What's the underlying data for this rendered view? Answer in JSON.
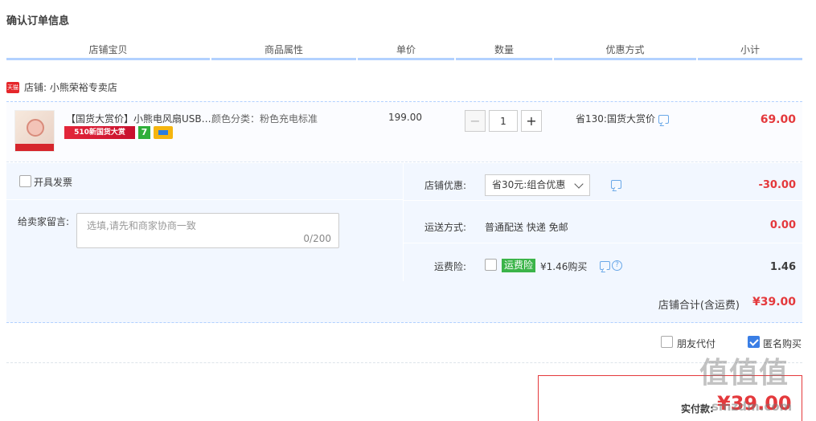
{
  "page": {
    "title": "确认订单信息"
  },
  "columns": [
    "店铺宝贝",
    "商品属性",
    "单价",
    "数量",
    "优惠方式",
    "小计"
  ],
  "shop": {
    "badge": "天猫",
    "label": "店铺: 小熊荣裕专卖店"
  },
  "item": {
    "title": "【国货大赏价】小熊电风扇USB小型",
    "promo_tag": "510新国货大赏",
    "badge_number": "7",
    "attributes": "颜色分类：粉色充电标准",
    "unit_price": "199.00",
    "quantity": "1",
    "discount": "省130:国货大赏价",
    "subtotal": "69.00"
  },
  "invoice": {
    "label": "开具发票"
  },
  "memo": {
    "label": "给卖家留言:",
    "placeholder": "选填,请先和商家协商一致",
    "counter": "0/200"
  },
  "shop_discount": {
    "label": "店铺优惠:",
    "selected": "省30元:组合优惠",
    "value": "-30.00"
  },
  "shipping": {
    "label": "运送方式:",
    "value": "普通配送 快递 免邮",
    "cost": "0.00"
  },
  "insurance": {
    "label": "运费险:",
    "tag": "运费险",
    "price": "¥1.46购买",
    "cost": "1.46"
  },
  "shop_total": {
    "label": "店铺合计(含运费)",
    "value": "¥39.00"
  },
  "buy_options": {
    "friend_pay": "朋友代付",
    "anonymous": "匿名购买",
    "anonymous_checked": true
  },
  "payment": {
    "label": "实付款:",
    "value": "¥39.00"
  },
  "watermark": {
    "logo": "值值值",
    "url": "smzdm.com"
  },
  "colors": {
    "accent": "#e4393c",
    "header_line": "#b2d1ff",
    "area_bg": "#f2f7ff",
    "insurance_green": "#3bb449"
  }
}
